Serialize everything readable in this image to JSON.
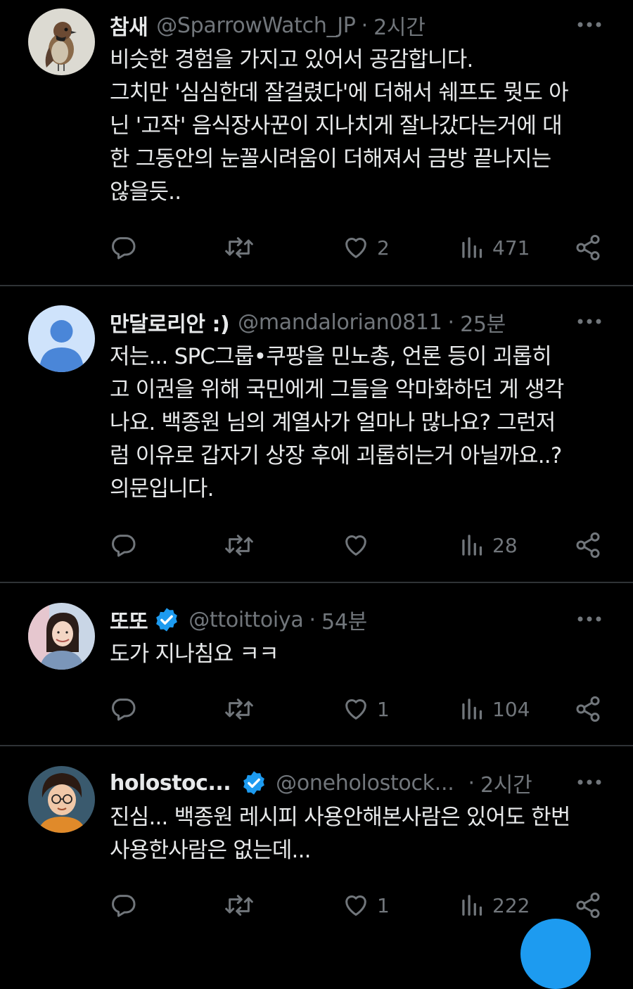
{
  "colors": {
    "background": "#000000",
    "text": "#e7e9ea",
    "muted": "#71767b",
    "divider": "#2f3336",
    "verified": "#1d9bf0"
  },
  "tweets": [
    {
      "name": "참새",
      "handle": "@SparrowWatch_JP",
      "dot": "·",
      "time": "2시간",
      "verified": false,
      "avatar": "sparrow-photo",
      "lines": [
        "비슷한 경험을 가지고 있어서 공감합니다.",
        "그치만 '심심한데 잘걸렸다'에 더해서 쉐프도 뭣도 아",
        "닌 '고작' 음식장사꾼이 지나치게 잘나갔다는거에 대",
        "한 그동안의 눈꼴시려움이 더해져서 금방 끝나지는",
        "않을듯.."
      ],
      "likes": "2",
      "views": "471"
    },
    {
      "name": "만달로리안 :)",
      "handle": "@mandalorian0811",
      "dot": "·",
      "time": "25분",
      "verified": false,
      "avatar": "default-person",
      "lines": [
        "저는... SPC그룹•쿠팡을  민노총, 언론 등이 괴롭히",
        "고 이권을 위해 국민에게 그들을 악마화하던 게 생각",
        "나요. 백종원 님의 계열사가 얼마나 많나요? 그런저",
        "럼 이유로 갑자기 상장 후에 괴롭히는거 아닐까요..?",
        "의문입니다."
      ],
      "likes": "",
      "views": "28"
    },
    {
      "name": "또또",
      "handle": "@ttoittoiya",
      "dot": "·",
      "time": "54분",
      "verified": true,
      "avatar": "woman-photo",
      "lines": [
        "도가 지나침요 ㅋㅋ"
      ],
      "likes": "1",
      "views": "104"
    },
    {
      "name": "holostoc...",
      "handle": "@oneholostock...",
      "dot": "·",
      "time": "2시간",
      "verified": true,
      "avatar": "anime-boy",
      "lines": [
        "진심... 백종원 레시피 사용안해본사람은 있어도 한번",
        "사용한사람은 없는데..."
      ],
      "likes": "1",
      "views": "222"
    }
  ],
  "icons": {
    "reply": "reply-bubble-icon",
    "retweet": "retweet-arrows-icon",
    "like": "heart-icon",
    "views": "bar-chart-icon",
    "share": "share-icon",
    "more": "more-dots-icon",
    "verified": "verified-badge-icon"
  }
}
